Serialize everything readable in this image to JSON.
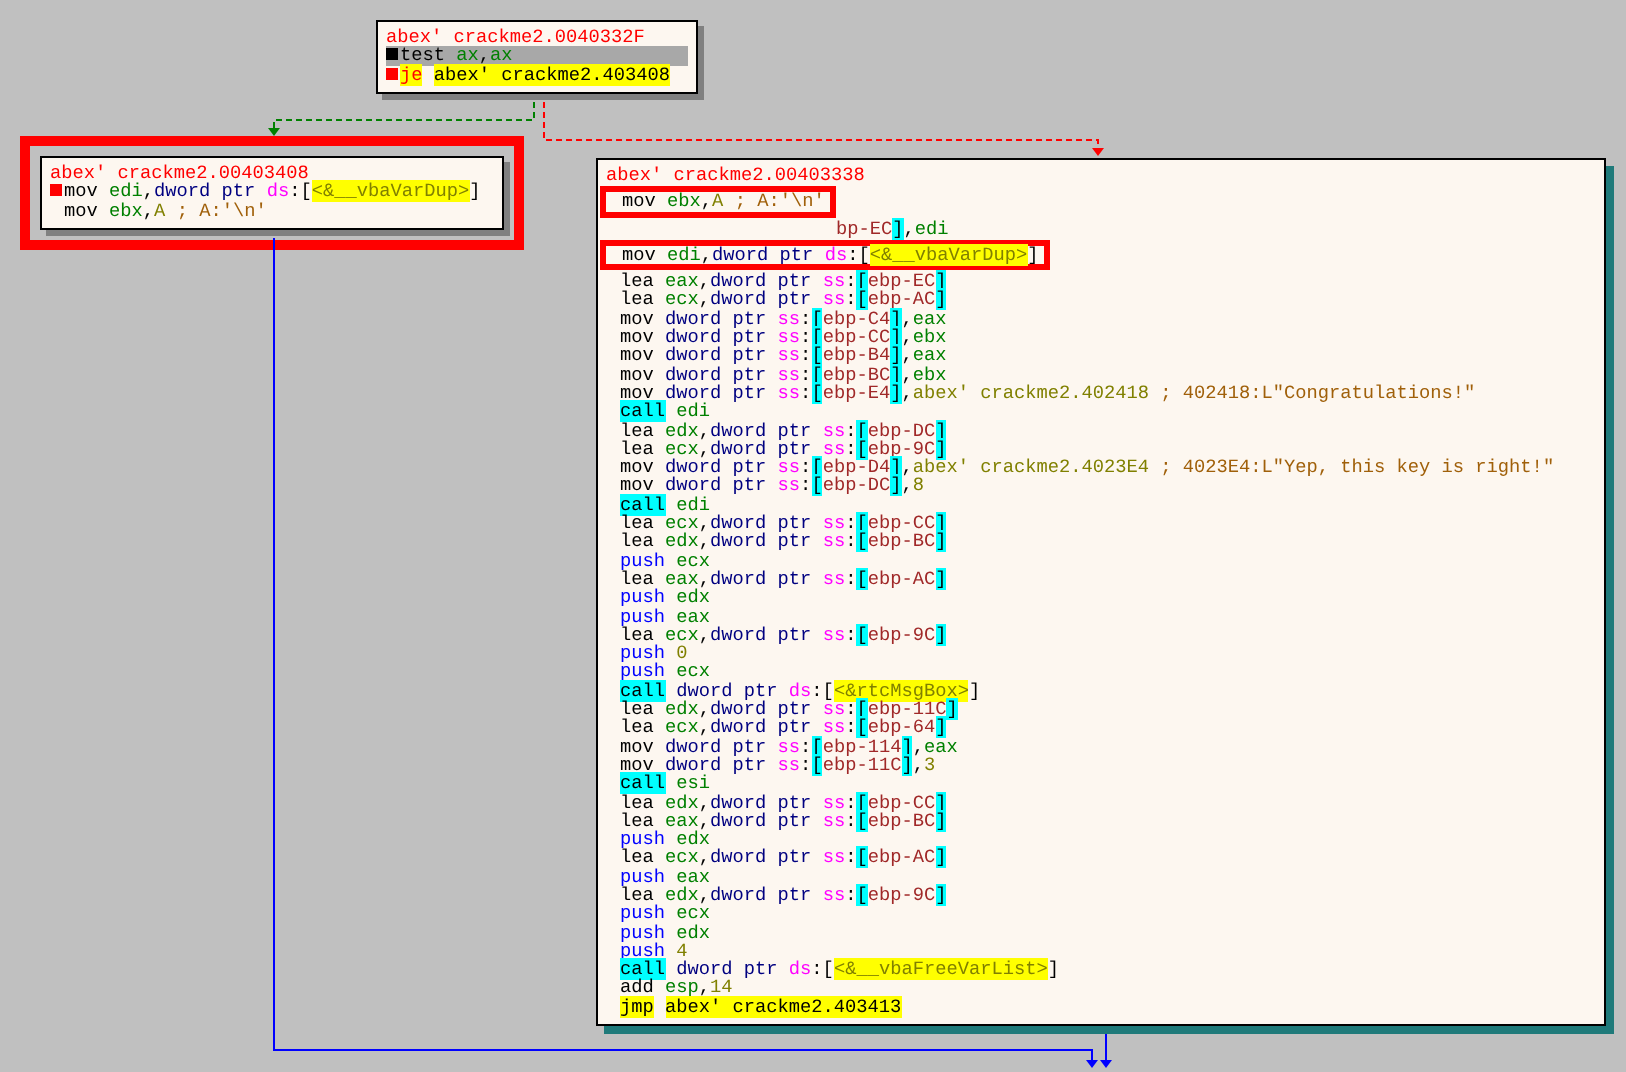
{
  "blocks": [
    {
      "highlighted": false,
      "lines": [
        {
          "kind": "title",
          "selected": false,
          "text": "abex' crackme2.0040332F"
        },
        {
          "kind": "code",
          "selected": true,
          "color": "#000000",
          "segs": [
            {
              "text": "test ",
              "kind": "op"
            },
            {
              "text": "ax",
              "kind": "reg"
            },
            {
              "text": ",",
              "kind": "p"
            },
            {
              "text": "ax",
              "kind": "reg"
            }
          ]
        },
        {
          "kind": "code",
          "selected": false,
          "color": "#ff0000",
          "segs": [
            {
              "text": "je",
              "kind": "jcc"
            },
            {
              "text": "abex' crackme2.403408",
              "kind": "lblhl"
            }
          ]
        }
      ]
    },
    {
      "highlighted": true,
      "lines": [
        {
          "kind": "title",
          "text": "abex' crackme2.00403408"
        },
        {
          "kind": "code",
          "color": "#ff0000",
          "segs": [
            {
              "text": "mov ",
              "kind": "op"
            },
            {
              "text": "edi",
              "kind": "reg"
            },
            {
              "text": ",",
              "kind": "p"
            },
            {
              "text": "dword ptr ",
              "kind": "sz"
            },
            {
              "text": "ds",
              "kind": "seg"
            },
            {
              "text": ":[",
              "kind": "p"
            },
            {
              "text": "<&__vbaVarDup>",
              "kind": "sym"
            },
            {
              "text": "]",
              "kind": "p"
            }
          ]
        },
        {
          "kind": "code",
          "segs": [
            {
              "text": "mov ",
              "kind": "op"
            },
            {
              "text": "ebx",
              "kind": "reg"
            },
            {
              "text": ",",
              "kind": "p"
            },
            {
              "text": "A",
              "kind": "num"
            },
            {
              "text": " ; A:'\\n'",
              "kind": "cmt"
            }
          ]
        }
      ]
    },
    {
      "highlighted": false,
      "lines": [
        {
          "kind": "title",
          "text": "abex' crackme2.00403338"
        },
        {
          "kind": "callout",
          "segs": [
            {
              "text": "mov ",
              "kind": "op"
            },
            {
              "text": "ebx",
              "kind": "reg"
            },
            {
              "text": ",",
              "kind": "p"
            },
            {
              "text": "A",
              "kind": "num"
            },
            {
              "text": " ; A:'\\n'",
              "kind": "cmt"
            }
          ]
        },
        {
          "kind": "fragment",
          "segs": [
            {
              "text": "bp-EC",
              "kind": "mem"
            },
            {
              "text": "]",
              "kind": "brk"
            },
            {
              "text": ",",
              "kind": "p"
            },
            {
              "text": "edi",
              "kind": "reg"
            }
          ]
        },
        {
          "kind": "callout",
          "segs": [
            {
              "text": "mov ",
              "kind": "op"
            },
            {
              "text": "edi",
              "kind": "reg"
            },
            {
              "text": ",",
              "kind": "p"
            },
            {
              "text": "dword ptr ",
              "kind": "sz"
            },
            {
              "text": "ds",
              "kind": "seg"
            },
            {
              "text": ":[",
              "kind": "p"
            },
            {
              "text": "<&__vbaVarDup>",
              "kind": "sym"
            },
            {
              "text": "]",
              "kind": "p"
            }
          ]
        },
        {
          "kind": "code",
          "segs": [
            {
              "text": "lea ",
              "kind": "op"
            },
            {
              "text": "eax",
              "kind": "reg"
            },
            {
              "text": ",",
              "kind": "p"
            },
            {
              "text": "dword ptr ",
              "kind": "sz"
            },
            {
              "text": "ss",
              "kind": "seg"
            },
            {
              "text": ":",
              "kind": "p"
            },
            {
              "text": "[",
              "kind": "brk"
            },
            {
              "text": "ebp-EC",
              "kind": "mem"
            },
            {
              "text": "]",
              "kind": "brk"
            }
          ]
        },
        {
          "kind": "code",
          "segs": [
            {
              "text": "lea ",
              "kind": "op"
            },
            {
              "text": "ecx",
              "kind": "reg"
            },
            {
              "text": ",",
              "kind": "p"
            },
            {
              "text": "dword ptr ",
              "kind": "sz"
            },
            {
              "text": "ss",
              "kind": "seg"
            },
            {
              "text": ":",
              "kind": "p"
            },
            {
              "text": "[",
              "kind": "brk"
            },
            {
              "text": "ebp-AC",
              "kind": "mem"
            },
            {
              "text": "]",
              "kind": "brk"
            }
          ]
        },
        {
          "kind": "code",
          "segs": [
            {
              "text": "mov ",
              "kind": "op"
            },
            {
              "text": "dword ptr ",
              "kind": "sz"
            },
            {
              "text": "ss",
              "kind": "seg"
            },
            {
              "text": ":",
              "kind": "p"
            },
            {
              "text": "[",
              "kind": "brk"
            },
            {
              "text": "ebp-C4",
              "kind": "mem"
            },
            {
              "text": "]",
              "kind": "brk"
            },
            {
              "text": ",",
              "kind": "p"
            },
            {
              "text": "eax",
              "kind": "reg"
            }
          ]
        },
        {
          "kind": "code",
          "segs": [
            {
              "text": "mov ",
              "kind": "op"
            },
            {
              "text": "dword ptr ",
              "kind": "sz"
            },
            {
              "text": "ss",
              "kind": "seg"
            },
            {
              "text": ":",
              "kind": "p"
            },
            {
              "text": "[",
              "kind": "brk"
            },
            {
              "text": "ebp-CC",
              "kind": "mem"
            },
            {
              "text": "]",
              "kind": "brk"
            },
            {
              "text": ",",
              "kind": "p"
            },
            {
              "text": "ebx",
              "kind": "reg"
            }
          ]
        },
        {
          "kind": "code",
          "segs": [
            {
              "text": "mov ",
              "kind": "op"
            },
            {
              "text": "dword ptr ",
              "kind": "sz"
            },
            {
              "text": "ss",
              "kind": "seg"
            },
            {
              "text": ":",
              "kind": "p"
            },
            {
              "text": "[",
              "kind": "brk"
            },
            {
              "text": "ebp-B4",
              "kind": "mem"
            },
            {
              "text": "]",
              "kind": "brk"
            },
            {
              "text": ",",
              "kind": "p"
            },
            {
              "text": "eax",
              "kind": "reg"
            }
          ]
        },
        {
          "kind": "code",
          "segs": [
            {
              "text": "mov ",
              "kind": "op"
            },
            {
              "text": "dword ptr ",
              "kind": "sz"
            },
            {
              "text": "ss",
              "kind": "seg"
            },
            {
              "text": ":",
              "kind": "p"
            },
            {
              "text": "[",
              "kind": "brk"
            },
            {
              "text": "ebp-BC",
              "kind": "mem"
            },
            {
              "text": "]",
              "kind": "brk"
            },
            {
              "text": ",",
              "kind": "p"
            },
            {
              "text": "ebx",
              "kind": "reg"
            }
          ]
        },
        {
          "kind": "code",
          "segs": [
            {
              "text": "mov ",
              "kind": "op"
            },
            {
              "text": "dword ptr ",
              "kind": "sz"
            },
            {
              "text": "ss",
              "kind": "seg"
            },
            {
              "text": ":",
              "kind": "p"
            },
            {
              "text": "[",
              "kind": "brk"
            },
            {
              "text": "ebp-E4",
              "kind": "mem"
            },
            {
              "text": "]",
              "kind": "brk"
            },
            {
              "text": ",",
              "kind": "p"
            },
            {
              "text": "abex' crackme2.402418",
              "kind": "lbl"
            },
            {
              "text": " ; 402418:L\"Congratulations!\"",
              "kind": "cmt"
            }
          ]
        },
        {
          "kind": "code",
          "segs": [
            {
              "text": "call",
              "kind": "call"
            },
            {
              "text": " edi",
              "kind": "reg"
            }
          ]
        },
        {
          "kind": "code",
          "segs": [
            {
              "text": "lea ",
              "kind": "op"
            },
            {
              "text": "edx",
              "kind": "reg"
            },
            {
              "text": ",",
              "kind": "p"
            },
            {
              "text": "dword ptr ",
              "kind": "sz"
            },
            {
              "text": "ss",
              "kind": "seg"
            },
            {
              "text": ":",
              "kind": "p"
            },
            {
              "text": "[",
              "kind": "brk"
            },
            {
              "text": "ebp-DC",
              "kind": "mem"
            },
            {
              "text": "]",
              "kind": "brk"
            }
          ]
        },
        {
          "kind": "code",
          "segs": [
            {
              "text": "lea ",
              "kind": "op"
            },
            {
              "text": "ecx",
              "kind": "reg"
            },
            {
              "text": ",",
              "kind": "p"
            },
            {
              "text": "dword ptr ",
              "kind": "sz"
            },
            {
              "text": "ss",
              "kind": "seg"
            },
            {
              "text": ":",
              "kind": "p"
            },
            {
              "text": "[",
              "kind": "brk"
            },
            {
              "text": "ebp-9C",
              "kind": "mem"
            },
            {
              "text": "]",
              "kind": "brk"
            }
          ]
        },
        {
          "kind": "code",
          "segs": [
            {
              "text": "mov ",
              "kind": "op"
            },
            {
              "text": "dword ptr ",
              "kind": "sz"
            },
            {
              "text": "ss",
              "kind": "seg"
            },
            {
              "text": ":",
              "kind": "p"
            },
            {
              "text": "[",
              "kind": "brk"
            },
            {
              "text": "ebp-D4",
              "kind": "mem"
            },
            {
              "text": "]",
              "kind": "brk"
            },
            {
              "text": ",",
              "kind": "p"
            },
            {
              "text": "abex' crackme2.4023E4",
              "kind": "lbl"
            },
            {
              "text": " ; 4023E4:L\"Yep, this key is right!\"",
              "kind": "cmt"
            }
          ]
        },
        {
          "kind": "code",
          "segs": [
            {
              "text": "mov ",
              "kind": "op"
            },
            {
              "text": "dword ptr ",
              "kind": "sz"
            },
            {
              "text": "ss",
              "kind": "seg"
            },
            {
              "text": ":",
              "kind": "p"
            },
            {
              "text": "[",
              "kind": "brk"
            },
            {
              "text": "ebp-DC",
              "kind": "mem"
            },
            {
              "text": "]",
              "kind": "brk"
            },
            {
              "text": ",",
              "kind": "p"
            },
            {
              "text": "8",
              "kind": "num"
            }
          ]
        },
        {
          "kind": "code",
          "segs": [
            {
              "text": "call",
              "kind": "call"
            },
            {
              "text": " edi",
              "kind": "reg"
            }
          ]
        },
        {
          "kind": "code",
          "segs": [
            {
              "text": "lea ",
              "kind": "op"
            },
            {
              "text": "ecx",
              "kind": "reg"
            },
            {
              "text": ",",
              "kind": "p"
            },
            {
              "text": "dword ptr ",
              "kind": "sz"
            },
            {
              "text": "ss",
              "kind": "seg"
            },
            {
              "text": ":",
              "kind": "p"
            },
            {
              "text": "[",
              "kind": "brk"
            },
            {
              "text": "ebp-CC",
              "kind": "mem"
            },
            {
              "text": "]",
              "kind": "brk"
            }
          ]
        },
        {
          "kind": "code",
          "segs": [
            {
              "text": "lea ",
              "kind": "op"
            },
            {
              "text": "edx",
              "kind": "reg"
            },
            {
              "text": ",",
              "kind": "p"
            },
            {
              "text": "dword ptr ",
              "kind": "sz"
            },
            {
              "text": "ss",
              "kind": "seg"
            },
            {
              "text": ":",
              "kind": "p"
            },
            {
              "text": "[",
              "kind": "brk"
            },
            {
              "text": "ebp-BC",
              "kind": "mem"
            },
            {
              "text": "]",
              "kind": "brk"
            }
          ]
        },
        {
          "kind": "code",
          "segs": [
            {
              "text": "push ",
              "kind": "push"
            },
            {
              "text": "ecx",
              "kind": "reg"
            }
          ]
        },
        {
          "kind": "code",
          "segs": [
            {
              "text": "lea ",
              "kind": "op"
            },
            {
              "text": "eax",
              "kind": "reg"
            },
            {
              "text": ",",
              "kind": "p"
            },
            {
              "text": "dword ptr ",
              "kind": "sz"
            },
            {
              "text": "ss",
              "kind": "seg"
            },
            {
              "text": ":",
              "kind": "p"
            },
            {
              "text": "[",
              "kind": "brk"
            },
            {
              "text": "ebp-AC",
              "kind": "mem"
            },
            {
              "text": "]",
              "kind": "brk"
            }
          ]
        },
        {
          "kind": "code",
          "segs": [
            {
              "text": "push ",
              "kind": "push"
            },
            {
              "text": "edx",
              "kind": "reg"
            }
          ]
        },
        {
          "kind": "code",
          "segs": [
            {
              "text": "push ",
              "kind": "push"
            },
            {
              "text": "eax",
              "kind": "reg"
            }
          ]
        },
        {
          "kind": "code",
          "segs": [
            {
              "text": "lea ",
              "kind": "op"
            },
            {
              "text": "ecx",
              "kind": "reg"
            },
            {
              "text": ",",
              "kind": "p"
            },
            {
              "text": "dword ptr ",
              "kind": "sz"
            },
            {
              "text": "ss",
              "kind": "seg"
            },
            {
              "text": ":",
              "kind": "p"
            },
            {
              "text": "[",
              "kind": "brk"
            },
            {
              "text": "ebp-9C",
              "kind": "mem"
            },
            {
              "text": "]",
              "kind": "brk"
            }
          ]
        },
        {
          "kind": "code",
          "segs": [
            {
              "text": "push ",
              "kind": "push"
            },
            {
              "text": "0",
              "kind": "num"
            }
          ]
        },
        {
          "kind": "code",
          "segs": [
            {
              "text": "push ",
              "kind": "push"
            },
            {
              "text": "ecx",
              "kind": "reg"
            }
          ]
        },
        {
          "kind": "code",
          "segs": [
            {
              "text": "call",
              "kind": "call"
            },
            {
              "text": " dword ptr ",
              "kind": "sz"
            },
            {
              "text": "ds",
              "kind": "seg"
            },
            {
              "text": ":[",
              "kind": "p"
            },
            {
              "text": "<&rtcMsgBox>",
              "kind": "sym"
            },
            {
              "text": "]",
              "kind": "p"
            }
          ]
        },
        {
          "kind": "code",
          "segs": [
            {
              "text": "lea ",
              "kind": "op"
            },
            {
              "text": "edx",
              "kind": "reg"
            },
            {
              "text": ",",
              "kind": "p"
            },
            {
              "text": "dword ptr ",
              "kind": "sz"
            },
            {
              "text": "ss",
              "kind": "seg"
            },
            {
              "text": ":",
              "kind": "p"
            },
            {
              "text": "[",
              "kind": "brk"
            },
            {
              "text": "ebp-11C",
              "kind": "mem"
            },
            {
              "text": "]",
              "kind": "brk"
            }
          ]
        },
        {
          "kind": "code",
          "segs": [
            {
              "text": "lea ",
              "kind": "op"
            },
            {
              "text": "ecx",
              "kind": "reg"
            },
            {
              "text": ",",
              "kind": "p"
            },
            {
              "text": "dword ptr ",
              "kind": "sz"
            },
            {
              "text": "ss",
              "kind": "seg"
            },
            {
              "text": ":",
              "kind": "p"
            },
            {
              "text": "[",
              "kind": "brk"
            },
            {
              "text": "ebp-64",
              "kind": "mem"
            },
            {
              "text": "]",
              "kind": "brk"
            }
          ]
        },
        {
          "kind": "code",
          "segs": [
            {
              "text": "mov ",
              "kind": "op"
            },
            {
              "text": "dword ptr ",
              "kind": "sz"
            },
            {
              "text": "ss",
              "kind": "seg"
            },
            {
              "text": ":",
              "kind": "p"
            },
            {
              "text": "[",
              "kind": "brk"
            },
            {
              "text": "ebp-114",
              "kind": "mem"
            },
            {
              "text": "]",
              "kind": "brk"
            },
            {
              "text": ",",
              "kind": "p"
            },
            {
              "text": "eax",
              "kind": "reg"
            }
          ]
        },
        {
          "kind": "code",
          "segs": [
            {
              "text": "mov ",
              "kind": "op"
            },
            {
              "text": "dword ptr ",
              "kind": "sz"
            },
            {
              "text": "ss",
              "kind": "seg"
            },
            {
              "text": ":",
              "kind": "p"
            },
            {
              "text": "[",
              "kind": "brk"
            },
            {
              "text": "ebp-11C",
              "kind": "mem"
            },
            {
              "text": "]",
              "kind": "brk"
            },
            {
              "text": ",",
              "kind": "p"
            },
            {
              "text": "3",
              "kind": "num"
            }
          ]
        },
        {
          "kind": "code",
          "segs": [
            {
              "text": "call",
              "kind": "call"
            },
            {
              "text": " esi",
              "kind": "reg"
            }
          ]
        },
        {
          "kind": "code",
          "segs": [
            {
              "text": "lea ",
              "kind": "op"
            },
            {
              "text": "edx",
              "kind": "reg"
            },
            {
              "text": ",",
              "kind": "p"
            },
            {
              "text": "dword ptr ",
              "kind": "sz"
            },
            {
              "text": "ss",
              "kind": "seg"
            },
            {
              "text": ":",
              "kind": "p"
            },
            {
              "text": "[",
              "kind": "brk"
            },
            {
              "text": "ebp-CC",
              "kind": "mem"
            },
            {
              "text": "]",
              "kind": "brk"
            }
          ]
        },
        {
          "kind": "code",
          "segs": [
            {
              "text": "lea ",
              "kind": "op"
            },
            {
              "text": "eax",
              "kind": "reg"
            },
            {
              "text": ",",
              "kind": "p"
            },
            {
              "text": "dword ptr ",
              "kind": "sz"
            },
            {
              "text": "ss",
              "kind": "seg"
            },
            {
              "text": ":",
              "kind": "p"
            },
            {
              "text": "[",
              "kind": "brk"
            },
            {
              "text": "ebp-BC",
              "kind": "mem"
            },
            {
              "text": "]",
              "kind": "brk"
            }
          ]
        },
        {
          "kind": "code",
          "segs": [
            {
              "text": "push ",
              "kind": "push"
            },
            {
              "text": "edx",
              "kind": "reg"
            }
          ]
        },
        {
          "kind": "code",
          "segs": [
            {
              "text": "lea ",
              "kind": "op"
            },
            {
              "text": "ecx",
              "kind": "reg"
            },
            {
              "text": ",",
              "kind": "p"
            },
            {
              "text": "dword ptr ",
              "kind": "sz"
            },
            {
              "text": "ss",
              "kind": "seg"
            },
            {
              "text": ":",
              "kind": "p"
            },
            {
              "text": "[",
              "kind": "brk"
            },
            {
              "text": "ebp-AC",
              "kind": "mem"
            },
            {
              "text": "]",
              "kind": "brk"
            }
          ]
        },
        {
          "kind": "code",
          "segs": [
            {
              "text": "push ",
              "kind": "push"
            },
            {
              "text": "eax",
              "kind": "reg"
            }
          ]
        },
        {
          "kind": "code",
          "segs": [
            {
              "text": "lea ",
              "kind": "op"
            },
            {
              "text": "edx",
              "kind": "reg"
            },
            {
              "text": ",",
              "kind": "p"
            },
            {
              "text": "dword ptr ",
              "kind": "sz"
            },
            {
              "text": "ss",
              "kind": "seg"
            },
            {
              "text": ":",
              "kind": "p"
            },
            {
              "text": "[",
              "kind": "brk"
            },
            {
              "text": "ebp-9C",
              "kind": "mem"
            },
            {
              "text": "]",
              "kind": "brk"
            }
          ]
        },
        {
          "kind": "code",
          "segs": [
            {
              "text": "push ",
              "kind": "push"
            },
            {
              "text": "ecx",
              "kind": "reg"
            }
          ]
        },
        {
          "kind": "code",
          "segs": [
            {
              "text": "push ",
              "kind": "push"
            },
            {
              "text": "edx",
              "kind": "reg"
            }
          ]
        },
        {
          "kind": "code",
          "segs": [
            {
              "text": "push ",
              "kind": "push"
            },
            {
              "text": "4",
              "kind": "num"
            }
          ]
        },
        {
          "kind": "code",
          "segs": [
            {
              "text": "call",
              "kind": "call"
            },
            {
              "text": " dword ptr ",
              "kind": "sz"
            },
            {
              "text": "ds",
              "kind": "seg"
            },
            {
              "text": ":[",
              "kind": "p"
            },
            {
              "text": "<&__vbaFreeVarList>",
              "kind": "sym"
            },
            {
              "text": "]",
              "kind": "p"
            }
          ]
        },
        {
          "kind": "code",
          "segs": [
            {
              "text": "add ",
              "kind": "op"
            },
            {
              "text": "esp",
              "kind": "reg"
            },
            {
              "text": ",",
              "kind": "p"
            },
            {
              "text": "14",
              "kind": "num"
            }
          ]
        },
        {
          "kind": "code",
          "segs": [
            {
              "text": "jmp",
              "kind": "jmp"
            },
            {
              "text": "abex' crackme2.403413",
              "kind": "lblhl"
            }
          ]
        }
      ]
    }
  ]
}
